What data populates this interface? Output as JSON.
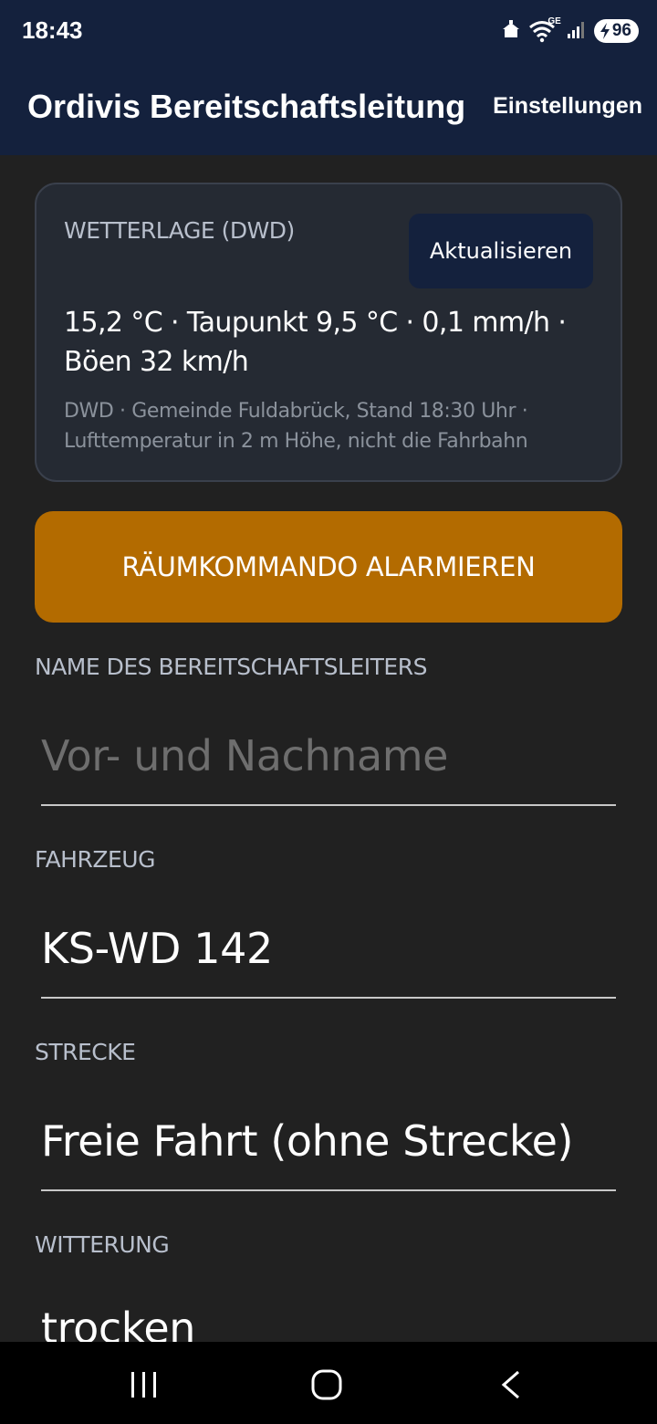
{
  "status_bar": {
    "time": "18:43",
    "battery_level": "96",
    "network_type": "GE",
    "icons": [
      "home-alert-icon",
      "wifi-icon",
      "signal-icon",
      "battery-charging-icon"
    ]
  },
  "app_bar": {
    "title": "Ordivis Bereitschaftsleitung",
    "settings_label": "Einstellungen"
  },
  "weather": {
    "heading": "WETTERLAGE (DWD)",
    "refresh_label": "Aktualisieren",
    "summary": "15,2 °C · Taupunkt 9,5 °C · 0,1 mm/h · Böen 32 km/h",
    "source": "DWD · Gemeinde Fuldabrück, Stand 18:30 Uhr · Lufttemperatur in 2 m Höhe, nicht die Fahrbahn"
  },
  "alarm_button_label": "RÄUMKOMMANDO ALARMIEREN",
  "form": {
    "name_label": "NAME DES BEREITSCHAFTSLEITERS",
    "name_placeholder": "Vor- und Nachname",
    "vehicle_label": "FAHRZEUG",
    "vehicle_value": "KS-WD 142",
    "route_label": "STRECKE",
    "route_value": "Freie Fahrt (ohne Strecke)",
    "weather_label": "WITTERUNG",
    "weather_value": "trocken"
  },
  "colors": {
    "header_bg": "#14213d",
    "page_bg": "#212121",
    "accent": "#b36b00",
    "card_bg": "#252a33"
  },
  "nav_icons": [
    "recent-apps-icon",
    "home-icon",
    "back-icon"
  ]
}
